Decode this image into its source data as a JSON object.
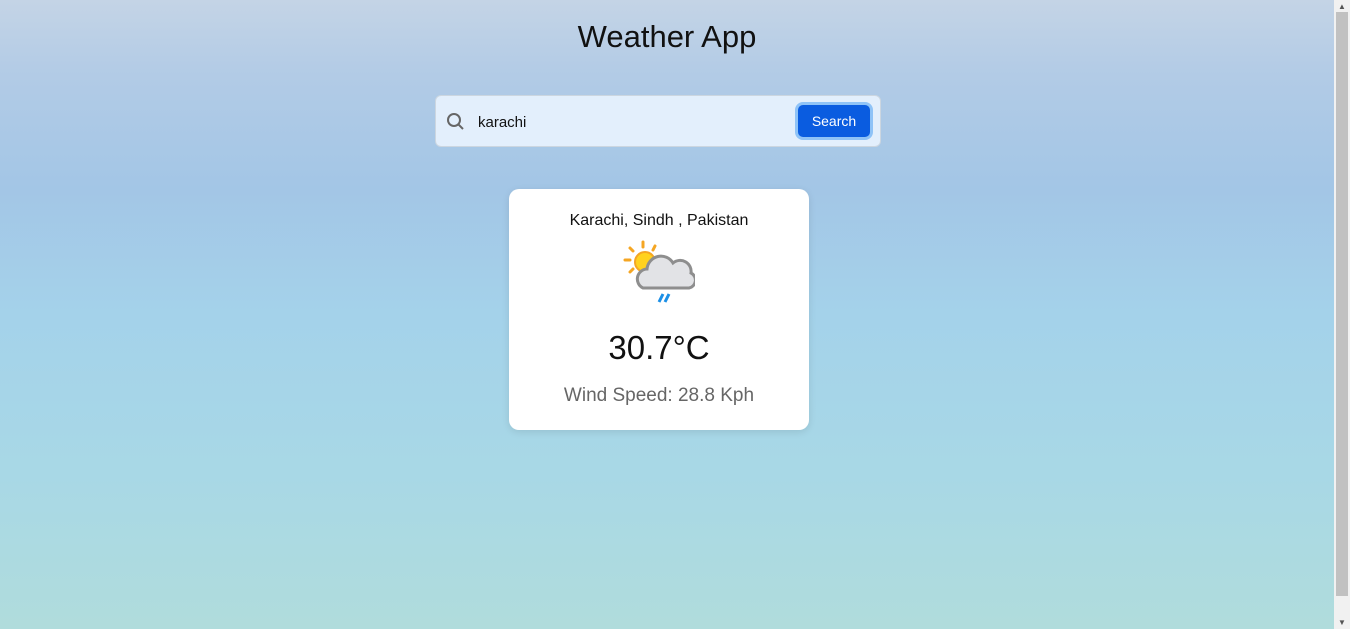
{
  "app": {
    "title": "Weather App"
  },
  "search": {
    "value": "karachi",
    "button_label": "Search",
    "icon": "search-icon"
  },
  "weather": {
    "location": "Karachi, Sindh , Pakistan",
    "icon": "partly-cloudy-rain-icon",
    "temperature": "30.7°C",
    "wind": "Wind Speed: 28.8 Kph"
  },
  "colors": {
    "button": "#0a5ce0"
  }
}
